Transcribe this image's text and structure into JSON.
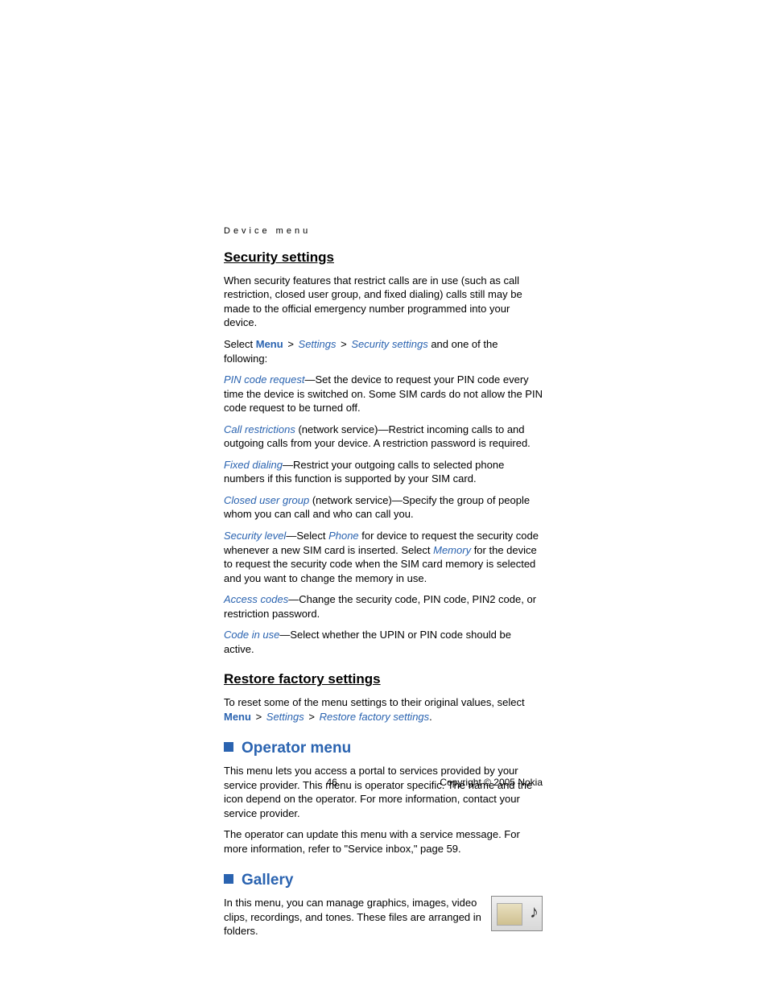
{
  "breadcrumb": "Device menu",
  "security": {
    "heading": "Security settings",
    "intro": "When security features that restrict calls are in use (such as call restriction, closed user group, and fixed dialing) calls still may be made to the official emergency number programmed into your device.",
    "select_prefix": "Select ",
    "menu": "Menu",
    "gt": " > ",
    "settings": "Settings",
    "security_settings": "Security settings",
    "select_suffix": " and one of the following:",
    "items": [
      {
        "term": "PIN code request",
        "rest": "—Set the device to request your PIN code every time the device is switched on. Some SIM cards do not allow the PIN code request to be turned off."
      },
      {
        "term": "Call restrictions",
        "rest": " (network service)—Restrict incoming calls to and outgoing calls from your device. A restriction password is required."
      },
      {
        "term": "Fixed dialing",
        "rest": "—Restrict your outgoing calls to selected phone numbers if this function is supported by your SIM card."
      },
      {
        "term": "Closed user group",
        "rest": " (network service)—Specify the group of people whom you can call and who can call you."
      }
    ],
    "seclevel": {
      "term": "Security level",
      "a": "—Select ",
      "phone": "Phone",
      "b": " for device to request the security code whenever a new SIM card is inserted. Select ",
      "memory": "Memory",
      "c": "  for the device to request the security code when the SIM card memory is selected and you want to change the memory in use."
    },
    "access": {
      "term": "Access codes",
      "rest": "—Change the security code, PIN code, PIN2 code, or restriction password."
    },
    "codeinuse": {
      "term": "Code in use",
      "rest": "—Select whether the UPIN or PIN code should be active."
    }
  },
  "restore": {
    "heading": "Restore factory settings",
    "a": "To reset some of the menu settings to their original values, select ",
    "menu": "Menu",
    "gt": " > ",
    "settings": "Settings",
    "rfs": "Restore factory settings",
    "period": "."
  },
  "operator": {
    "heading": "Operator menu",
    "p1": "This menu lets you access a portal to services provided by your service provider. This menu is operator specific. The name and the icon depend on the operator. For more information, contact your service provider.",
    "p2": "The operator can update this menu with a service message. For more information, refer to \"Service inbox,\" page 59."
  },
  "gallery": {
    "heading": "Gallery",
    "p1": "In this menu, you can manage graphics, images, video clips, recordings, and tones. These files are arranged in folders."
  },
  "footer": {
    "page": "46",
    "copyright": "Copyright © 2005 Nokia"
  }
}
